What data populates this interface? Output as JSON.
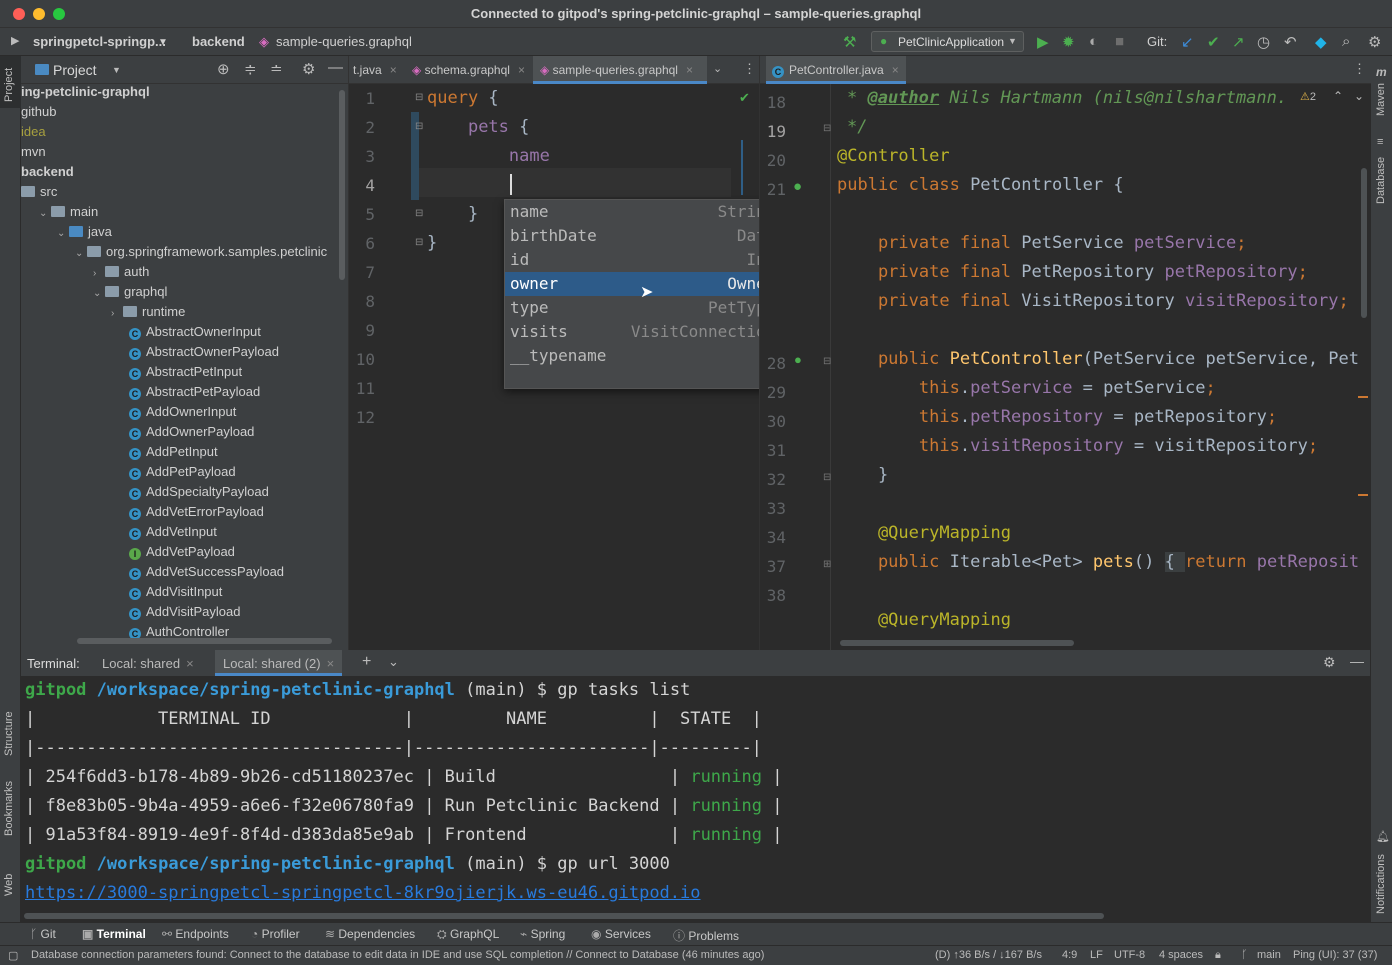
{
  "window": {
    "title": "Connected to gitpod's spring-petclinic-graphql – sample-queries.graphql"
  },
  "navbar": {
    "project": "springpetcl-springp...",
    "breadcrumb_dir": "backend",
    "breadcrumb_file": "sample-queries.graphql",
    "run_config": "PetClinicApplication",
    "git_label": "Git:"
  },
  "left_strip": {
    "project": "Project",
    "structure": "Structure",
    "bookmarks": "Bookmarks",
    "web": "Web"
  },
  "right_strip": {
    "maven": "Maven",
    "database": "Database",
    "notifications": "Notifications"
  },
  "project_panel": {
    "title": "Project",
    "tree": [
      {
        "label": "ing-petclinic-graphql",
        "kind": "root",
        "indent": 0
      },
      {
        "label": "github",
        "kind": "plain",
        "indent": 0
      },
      {
        "label": "idea",
        "kind": "idea",
        "indent": 0
      },
      {
        "label": "mvn",
        "kind": "plain",
        "indent": 0
      },
      {
        "label": "backend",
        "kind": "bold",
        "indent": 0
      },
      {
        "label": "src",
        "kind": "folder",
        "indent": 0
      },
      {
        "label": "main",
        "kind": "folder-open",
        "indent": 1
      },
      {
        "label": "java",
        "kind": "folder-open-blue",
        "indent": 2
      },
      {
        "label": "org.springframework.samples.petclinic",
        "kind": "folder-open",
        "indent": 3
      },
      {
        "label": "auth",
        "kind": "folder-closed",
        "indent": 4
      },
      {
        "label": "graphql",
        "kind": "folder-open",
        "indent": 4
      },
      {
        "label": "runtime",
        "kind": "folder-closed",
        "indent": 5
      },
      {
        "label": "AbstractOwnerInput",
        "kind": "class",
        "indent": 6
      },
      {
        "label": "AbstractOwnerPayload",
        "kind": "class",
        "indent": 6
      },
      {
        "label": "AbstractPetInput",
        "kind": "class",
        "indent": 6
      },
      {
        "label": "AbstractPetPayload",
        "kind": "class",
        "indent": 6
      },
      {
        "label": "AddOwnerInput",
        "kind": "class",
        "indent": 6
      },
      {
        "label": "AddOwnerPayload",
        "kind": "class",
        "indent": 6
      },
      {
        "label": "AddPetInput",
        "kind": "class",
        "indent": 6
      },
      {
        "label": "AddPetPayload",
        "kind": "class",
        "indent": 6
      },
      {
        "label": "AddSpecialtyPayload",
        "kind": "class",
        "indent": 6
      },
      {
        "label": "AddVetErrorPayload",
        "kind": "class",
        "indent": 6
      },
      {
        "label": "AddVetInput",
        "kind": "class",
        "indent": 6
      },
      {
        "label": "AddVetPayload",
        "kind": "interface",
        "indent": 6
      },
      {
        "label": "AddVetSuccessPayload",
        "kind": "class",
        "indent": 6
      },
      {
        "label": "AddVisitInput",
        "kind": "class",
        "indent": 6
      },
      {
        "label": "AddVisitPayload",
        "kind": "class",
        "indent": 6
      },
      {
        "label": "AuthController",
        "kind": "class",
        "indent": 6
      }
    ]
  },
  "editor1": {
    "tabs": [
      "t.java",
      "schema.graphql",
      "sample-queries.graphql"
    ],
    "line_numbers": [
      "1",
      "2",
      "3",
      "4",
      "5",
      "6",
      "7",
      "8",
      "9",
      "10",
      "11",
      "12"
    ],
    "code": [
      "query {",
      "    pets {",
      "        name",
      "",
      "    }",
      "}"
    ],
    "completion": [
      {
        "name": "name",
        "type": "String!"
      },
      {
        "name": "birthDate",
        "type": "Date!"
      },
      {
        "name": "id",
        "type": "Int!"
      },
      {
        "name": "owner",
        "type": "Owner!"
      },
      {
        "name": "type",
        "type": "PetType!"
      },
      {
        "name": "visits",
        "type": "VisitConnection!"
      },
      {
        "name": "__typename",
        "type": ""
      }
    ]
  },
  "editor2": {
    "tab": "PetController.java",
    "warning_count": "2",
    "line_numbers": [
      "18",
      "19",
      "20",
      "21",
      "",
      "",
      "",
      "",
      "",
      "28",
      "29",
      "30",
      "31",
      "32",
      "33",
      "34",
      "37",
      "38"
    ],
    "lines": [
      {
        "parts": [
          [
            "* ",
            "comment"
          ],
          [
            "@author",
            "doctag"
          ],
          [
            " Nils Hartmann (nils@nilshartmann.",
            "comment"
          ]
        ]
      },
      {
        "parts": [
          [
            "*/",
            "comment"
          ]
        ]
      },
      {
        "parts": [
          [
            "@Controller",
            "annotation"
          ]
        ]
      },
      {
        "parts": [
          [
            "public class ",
            "keyword"
          ],
          [
            "PetController {",
            "plain"
          ]
        ]
      },
      {
        "parts": []
      },
      {
        "parts": [
          [
            "    private final ",
            "keyword"
          ],
          [
            "PetService ",
            "plain"
          ],
          [
            "petService",
            "field"
          ],
          [
            ";",
            "keyword"
          ]
        ]
      },
      {
        "parts": [
          [
            "    private final ",
            "keyword"
          ],
          [
            "PetRepository ",
            "plain"
          ],
          [
            "petRepository",
            "field"
          ],
          [
            ";",
            "keyword"
          ]
        ]
      },
      {
        "parts": [
          [
            "    private final ",
            "keyword"
          ],
          [
            "VisitRepository ",
            "plain"
          ],
          [
            "visitRepository",
            "field"
          ],
          [
            ";",
            "keyword"
          ]
        ]
      },
      {
        "parts": []
      },
      {
        "parts": [
          [
            "    public ",
            "keyword"
          ],
          [
            "PetController",
            "method"
          ],
          [
            "(PetService petService, Pet",
            "plain"
          ]
        ]
      },
      {
        "parts": [
          [
            "        this",
            "keyword"
          ],
          [
            ".",
            "plain"
          ],
          [
            "petService",
            "field"
          ],
          [
            " = petService",
            ""
          ],
          [
            ";",
            "keyword"
          ]
        ]
      },
      {
        "parts": [
          [
            "        this",
            "keyword"
          ],
          [
            ".",
            "plain"
          ],
          [
            "petRepository",
            "field"
          ],
          [
            " = petRepository",
            ""
          ],
          [
            ";",
            "keyword"
          ]
        ]
      },
      {
        "parts": [
          [
            "        this",
            "keyword"
          ],
          [
            ".",
            "plain"
          ],
          [
            "visitRepository",
            "field"
          ],
          [
            " = visitRepository",
            ""
          ],
          [
            ";",
            "keyword"
          ]
        ]
      },
      {
        "parts": [
          [
            "    }",
            "plain"
          ]
        ]
      },
      {
        "parts": []
      },
      {
        "parts": [
          [
            "    @QueryMapping",
            "annotation"
          ]
        ]
      },
      {
        "parts": [
          [
            "    public ",
            "keyword"
          ],
          [
            "Iterable<Pet> ",
            "plain"
          ],
          [
            "pets",
            "method"
          ],
          [
            "() ",
            "plain"
          ],
          [
            "{ ",
            "fold"
          ],
          [
            "return ",
            "keyword"
          ],
          [
            "petReposit",
            "field"
          ]
        ]
      },
      {
        "parts": []
      },
      {
        "parts": [
          [
            "    @QueryMapping",
            "annotation"
          ]
        ]
      }
    ]
  },
  "terminal": {
    "label": "Terminal:",
    "tabs": [
      "Local: shared",
      "Local: shared (2)"
    ],
    "prompt_user": "gitpod",
    "prompt_path": "/workspace/spring-petclinic-graphql",
    "prompt_branch": " (main) $ ",
    "cmd1": "gp tasks list",
    "header": "|            TERMINAL ID             |         NAME          |  STATE  |",
    "sep": "|------------------------------------|-----------------------|---------|",
    "rows": [
      {
        "id": "254f6dd3-b178-4b89-9b26-cd51180237ec",
        "name": "Build                ",
        "state": "running"
      },
      {
        "id": "f8e83b05-9b4a-4959-a6e6-f32e06780fa9",
        "name": "Run Petclinic Backend",
        "state": "running"
      },
      {
        "id": "91a53f84-8919-4e9f-8f4d-d383da85e9ab",
        "name": "Frontend             ",
        "state": "running"
      }
    ],
    "cmd2": "gp url 3000",
    "url": "https://3000-springpetcl-springpetcl-8kr9ojierjk.ws-eu46.gitpod.io"
  },
  "toolwindows": [
    "Git",
    "Terminal",
    "Endpoints",
    "Profiler",
    "Dependencies",
    "GraphQL",
    "Spring",
    "Services",
    "Problems"
  ],
  "status": {
    "message": "Database connection parameters found: Connect to the database to edit data in IDE and use SQL completion // Connect to Database (46 minutes ago)",
    "net": "(D) ↑36 B/s / ↓167 B/s",
    "pos": "4:9",
    "lf": "LF",
    "enc": "UTF-8",
    "indent": "4 spaces",
    "branch": "main",
    "ping": "Ping (UI): 37 (37)"
  },
  "colors": {
    "keyword": "#cc7832",
    "field": "#9876aa",
    "annotation": "#bbb529",
    "method": "#ffc66d",
    "comment": "#629755",
    "green": "#3ea84a",
    "link": "#287bde",
    "path": "#3a9bd9"
  }
}
